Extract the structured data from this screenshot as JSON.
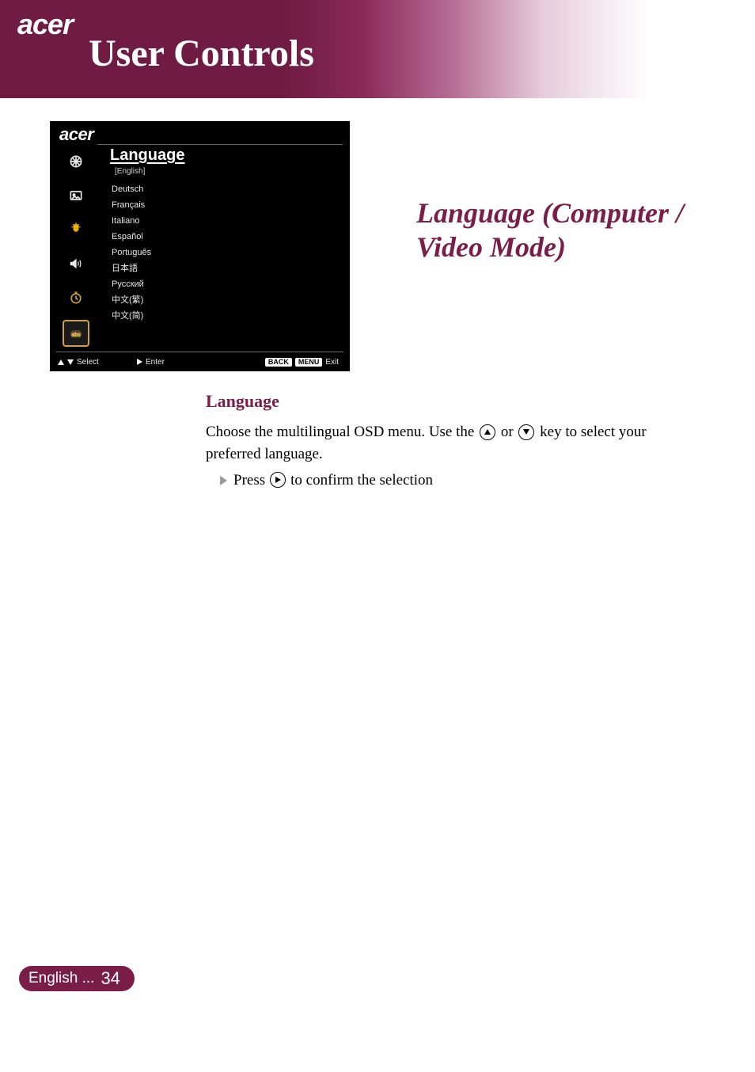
{
  "brand": "acer",
  "page_title": "User Controls",
  "osd": {
    "brand": "acer",
    "heading": "Language",
    "current": "[English]",
    "options": [
      "Deutsch",
      "Français",
      "Italiano",
      "Español",
      "Português",
      "日本語",
      "Русский",
      "中文(繁)",
      "中文(简)"
    ],
    "footer": {
      "select": "Select",
      "enter": "Enter",
      "back": "BACK",
      "menu": "MENU",
      "exit": "Exit"
    }
  },
  "section_title": "Language (Computer / Video Mode)",
  "body": {
    "heading": "Language",
    "p1a": "Choose the multilingual OSD menu. Use the ",
    "p1b": " or ",
    "p1c": " key to select your preferred language.",
    "p2a": "Press ",
    "p2b": " to confirm the selection"
  },
  "footer": {
    "language": "English ...",
    "page_number": "34"
  }
}
